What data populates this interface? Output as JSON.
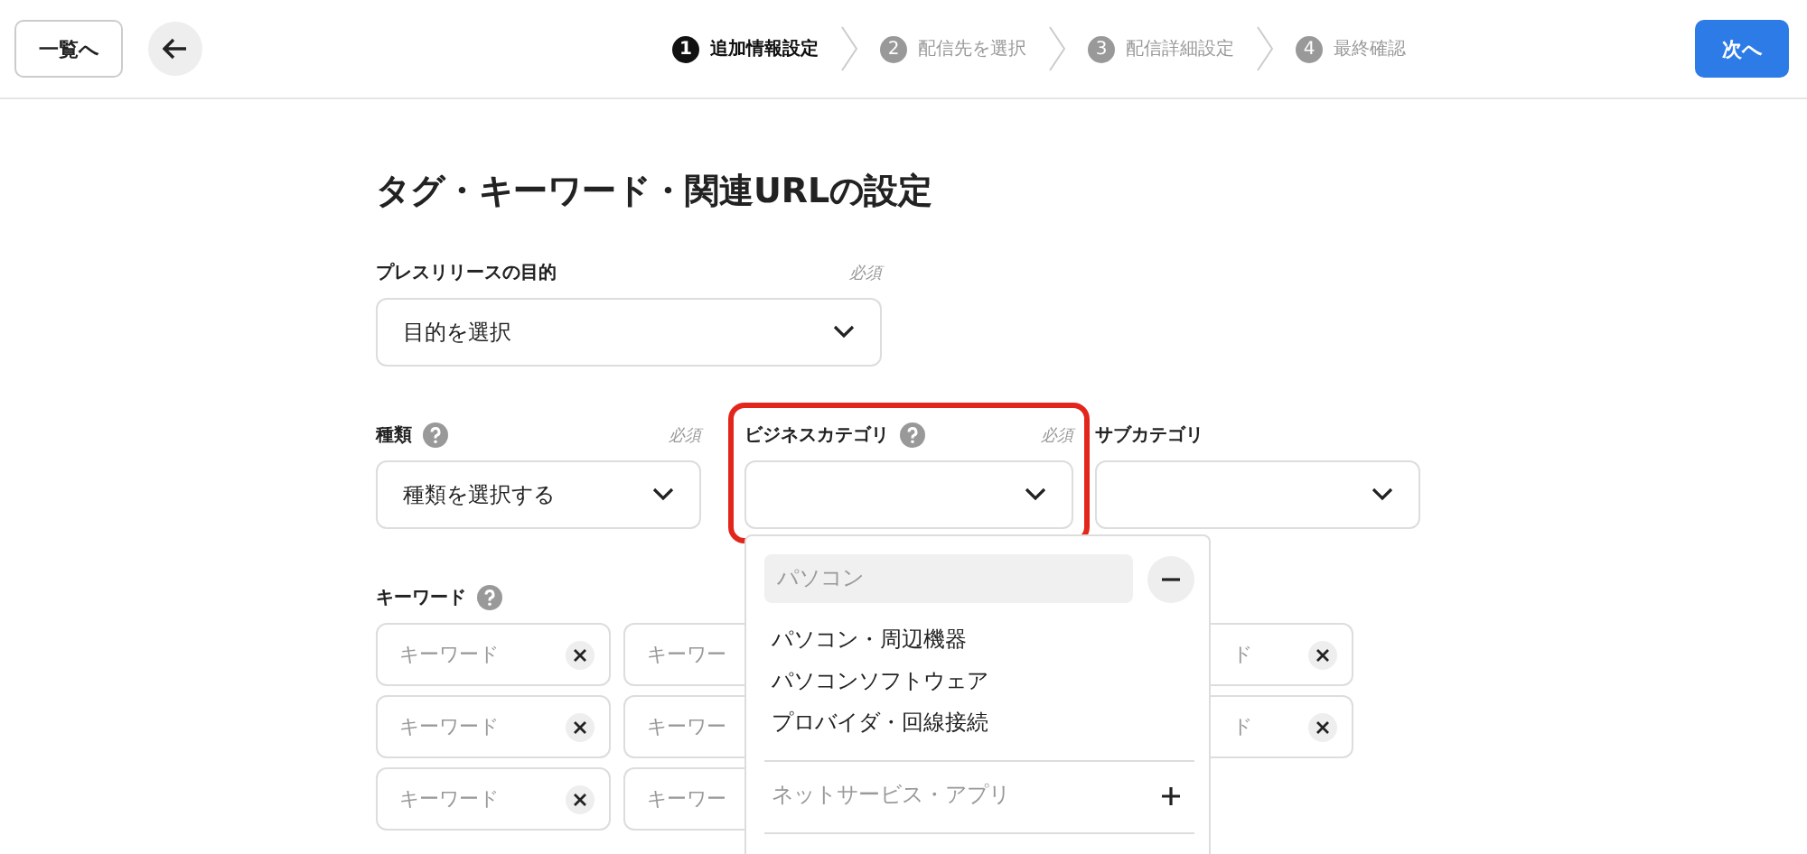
{
  "header": {
    "list_button": "一覧へ",
    "next_button": "次へ",
    "steps": [
      {
        "number": "1",
        "label": "追加情報設定",
        "selected": true
      },
      {
        "number": "2",
        "label": "配信先を選択",
        "selected": false
      },
      {
        "number": "3",
        "label": "配信詳細設定",
        "selected": false
      },
      {
        "number": "4",
        "label": "最終確認",
        "selected": false
      }
    ]
  },
  "title": "タグ・キーワード・関連URLの設定",
  "purpose": {
    "label": "プレスリリースの目的",
    "required": "必須",
    "value": "目的を選択"
  },
  "selects": [
    {
      "label": "種類",
      "help": true,
      "required": "必須",
      "value": "種類を選択する"
    },
    {
      "label": "ビジネスカテゴリ",
      "help": true,
      "required": "必須",
      "highlighted": true
    },
    {
      "label": "サブカテゴリ"
    }
  ],
  "keywords": {
    "label": "キーワード",
    "rows": [
      {
        "cells": [
          "キーワード",
          "キーワー",
          "ド"
        ]
      },
      {
        "cells": [
          "キーワード",
          "キーワー",
          "ド"
        ]
      },
      {
        "cells": [
          "キーワード",
          "キーワー"
        ]
      }
    ]
  },
  "dropdown": {
    "groups": [
      {
        "label": "パソコン",
        "expanded": true,
        "items": [
          "パソコン・周辺機器",
          "パソコンソフトウェア",
          "プロバイダ・回線接続"
        ]
      },
      {
        "label": "ネットサービス・アプリ",
        "expanded": false
      }
    ]
  }
}
